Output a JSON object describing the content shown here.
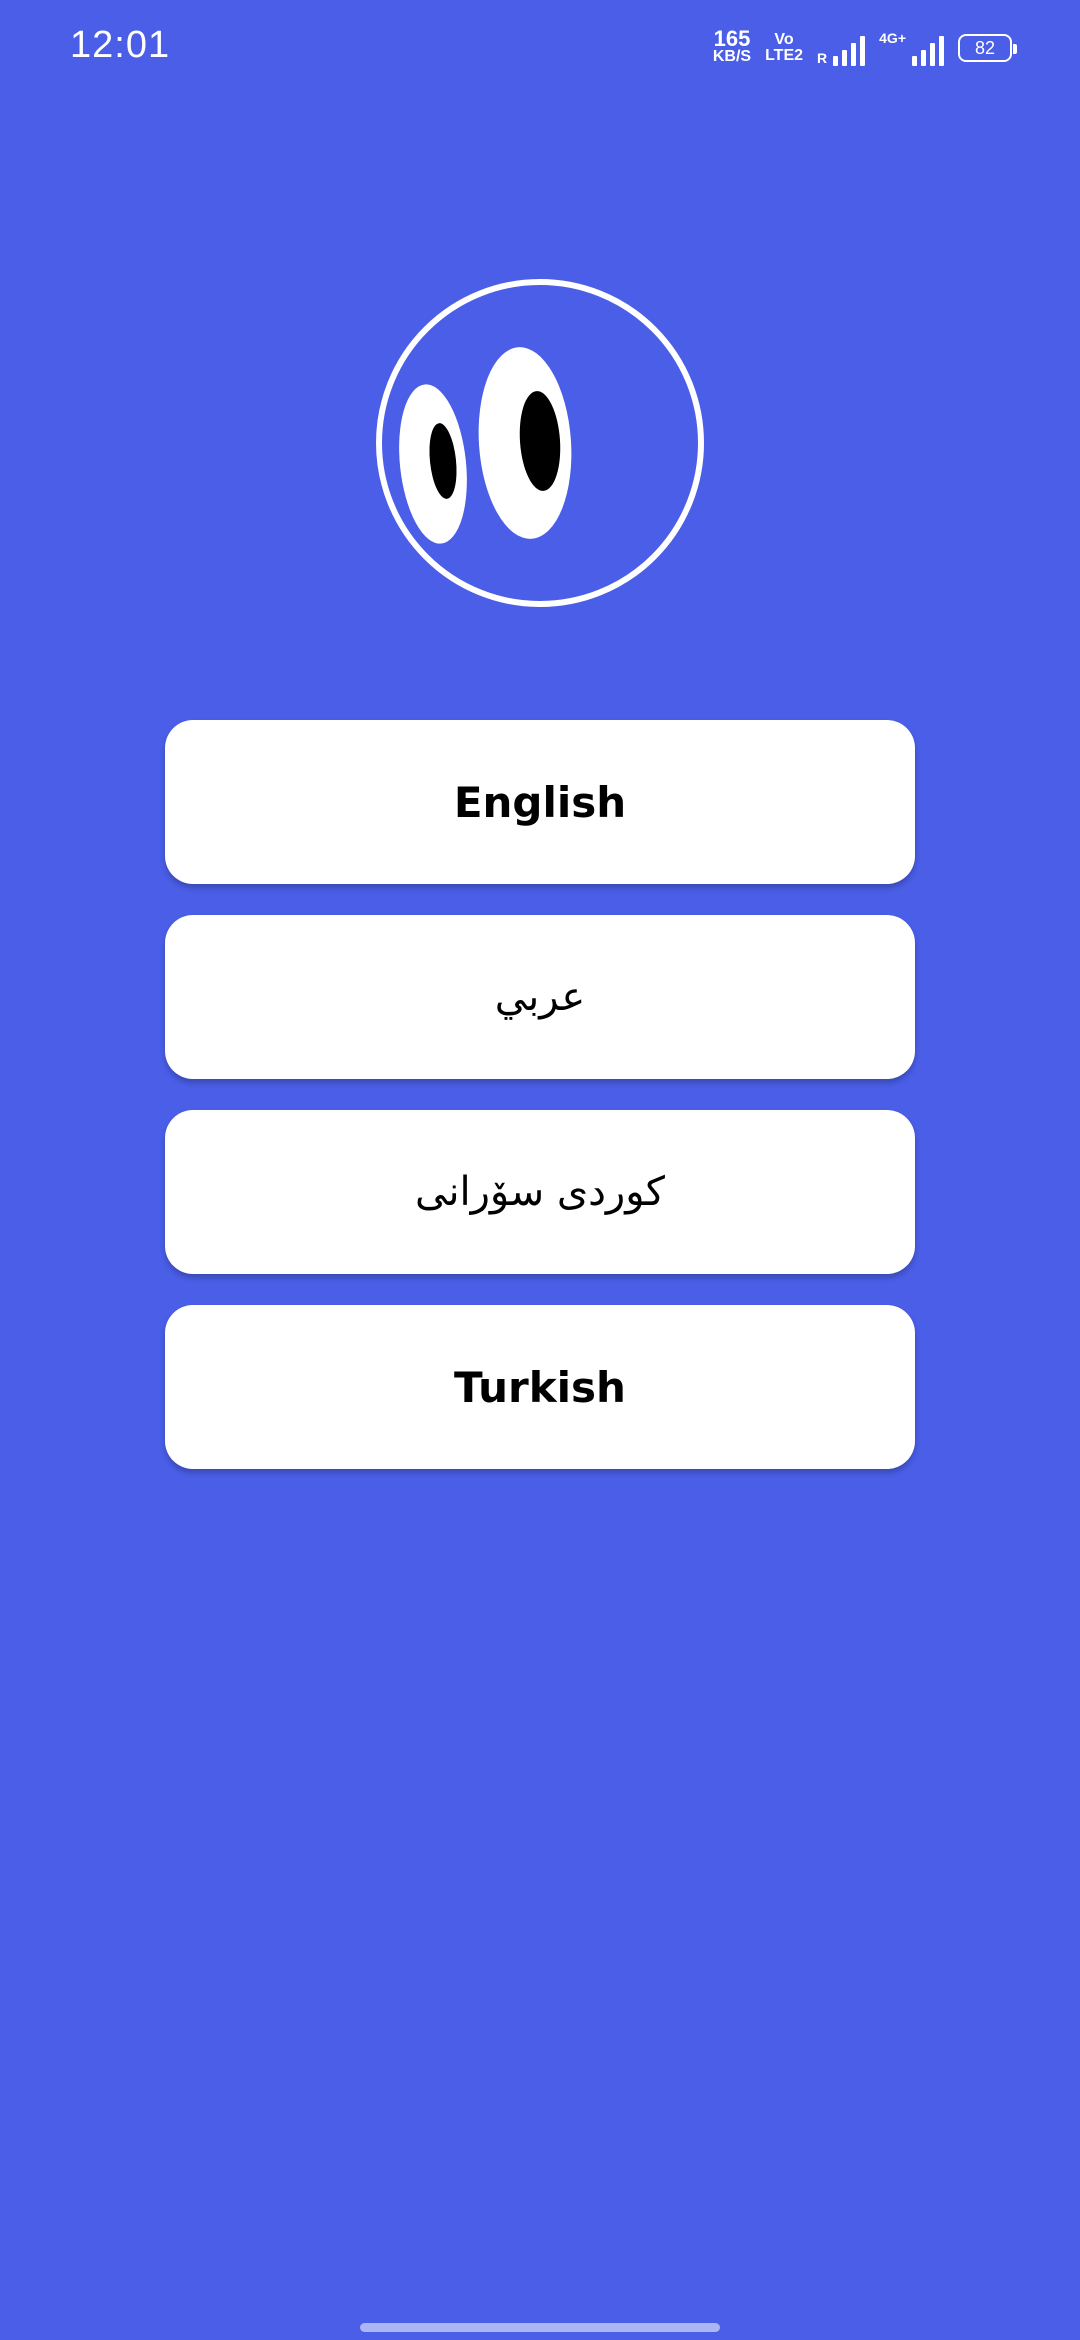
{
  "status_bar": {
    "time": "12:01",
    "net_speed_value": "165",
    "net_speed_unit": "KB/S",
    "volte_top": "Vo",
    "volte_bottom": "LTE2",
    "sim1_label": "R",
    "sim2_label": "4G+",
    "battery": "82",
    "icons": [
      "network-speed-icon",
      "volte-icon",
      "signal-icon",
      "signal-4g-icon",
      "battery-icon"
    ]
  },
  "logo": {
    "icon": "eyes-logo-icon"
  },
  "languages": [
    {
      "label": "English"
    },
    {
      "label": "عربي"
    },
    {
      "label": "کوردی سۆرانی"
    },
    {
      "label": "Turkish"
    }
  ],
  "colors": {
    "background": "#4a5ee8",
    "button": "#ffffff",
    "text": "#000000"
  }
}
